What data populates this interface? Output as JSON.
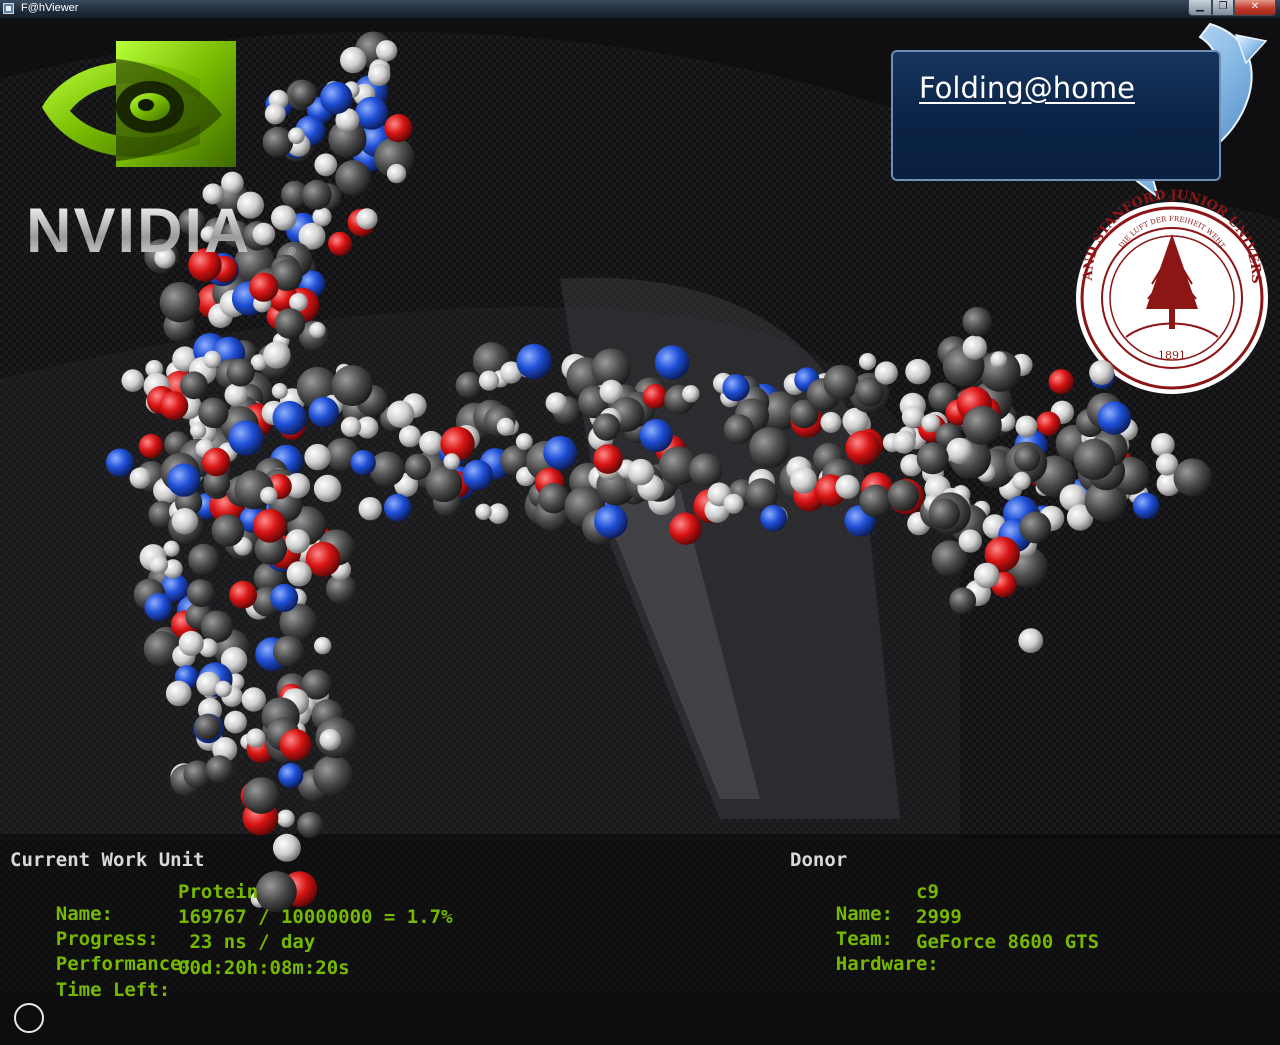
{
  "window": {
    "title": "F@hViewer",
    "minimize_glyph": "▁",
    "maximize_glyph": "❐",
    "close_glyph": "✕"
  },
  "branding": {
    "nvidia_wordmark": "NVIDIA",
    "nvidia_registered": "®",
    "folding_home": "Folding@home",
    "seal": {
      "arc_text": "LELAND STANFORD JUNIOR UNIVERSITY",
      "motto": "DIE LUFT DER FREIHEIT WEHT",
      "year": "1891"
    }
  },
  "work_unit": {
    "heading": "Current Work Unit",
    "rows": [
      {
        "label": "Name:",
        "value": "Protein"
      },
      {
        "label": "Progress:",
        "value": "169767 / 10000000 = 1.7%"
      },
      {
        "label": "Performance:",
        "value": " 23 ns / day"
      },
      {
        "label": "Time Left:",
        "value": "00d:20h:08m:20s"
      }
    ]
  },
  "donor": {
    "heading": "Donor",
    "rows": [
      {
        "label": "Name:",
        "value": "c9"
      },
      {
        "label": "Team:",
        "value": "2999"
      },
      {
        "label": "Hardware:",
        "value": "GeForce 8600 GTS"
      }
    ]
  },
  "colors": {
    "hud_green": "#76b900",
    "heading_gray": "#d9d9d9",
    "nvidia_green": "#76b900",
    "fah_blue": "#0b2346",
    "stanford_red": "#8c1515",
    "atom_carbon": "#5a5a5a",
    "atom_hydrogen": "#e6e6e6",
    "atom_oxygen": "#e01919",
    "atom_nitrogen": "#1f4fd6"
  },
  "icons": [
    "app-window-icon",
    "minimize-icon",
    "maximize-icon",
    "close-icon",
    "nvidia-eye-logo",
    "folding-arrow-icon",
    "stanford-seal",
    "protein-molecule"
  ]
}
